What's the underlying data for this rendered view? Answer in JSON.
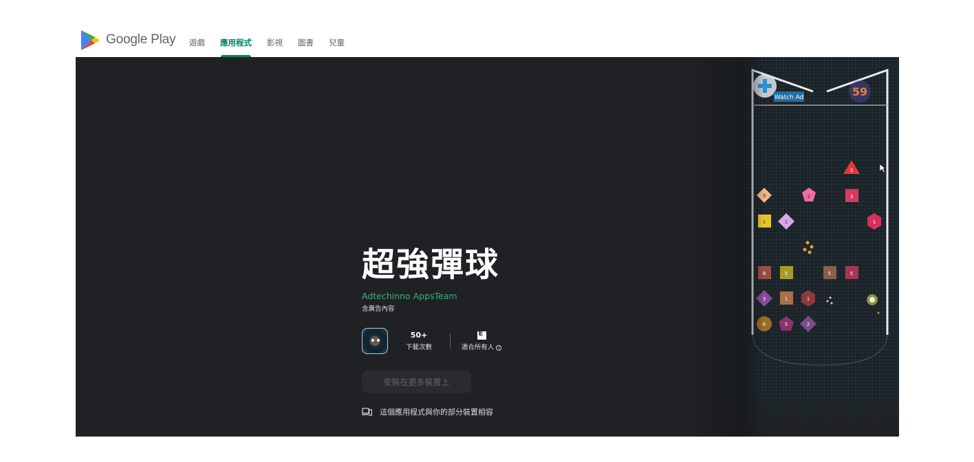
{
  "header": {
    "logo_text": "Google Play",
    "nav": [
      {
        "label": "遊戲",
        "active": false
      },
      {
        "label": "應用程式",
        "active": true
      },
      {
        "label": "影視",
        "active": false
      },
      {
        "label": "圖書",
        "active": false
      },
      {
        "label": "兒童",
        "active": false
      }
    ]
  },
  "app": {
    "title": "超強彈球",
    "developer": "Adtechinno AppsTeam",
    "ads_note": "含廣告內容",
    "downloads_value": "50+",
    "downloads_label": "下載次數",
    "rating_label": "適合所有人",
    "rating_badge": "E",
    "install_label": "安裝在更多裝置上",
    "compat_text": "這個應用程式與你的部分裝置相容"
  },
  "screenshot": {
    "watch_ad_label": "Watch Ad",
    "counter": "59",
    "blocks": [
      "9",
      "2",
      "3",
      "3",
      "1",
      "1",
      "1",
      "8",
      "5",
      "5",
      "5",
      "3",
      "1",
      "1",
      "6",
      "5",
      "2"
    ]
  },
  "colors": {
    "accent": "#01875f",
    "developer": "#3eb07c",
    "hero_bg": "#202124"
  }
}
